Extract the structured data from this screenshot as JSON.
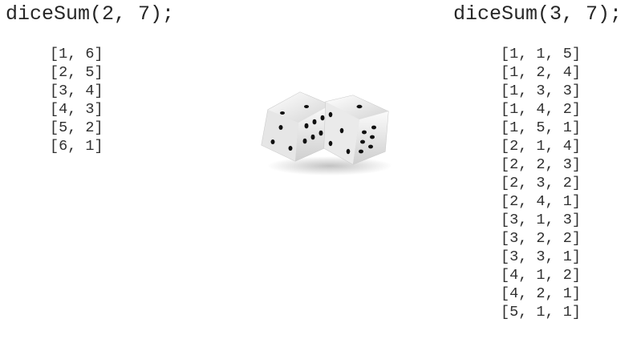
{
  "left": {
    "call": "diceSum(2, 7);",
    "results": [
      "[1, 6]",
      "[2, 5]",
      "[3, 4]",
      "[4, 3]",
      "[5, 2]",
      "[6, 1]"
    ]
  },
  "right": {
    "call": "diceSum(3, 7);",
    "results": [
      "[1, 1, 5]",
      "[1, 2, 4]",
      "[1, 3, 3]",
      "[1, 4, 2]",
      "[1, 5, 1]",
      "[2, 1, 4]",
      "[2, 2, 3]",
      "[2, 3, 2]",
      "[2, 4, 1]",
      "[3, 1, 3]",
      "[3, 2, 2]",
      "[3, 3, 1]",
      "[4, 1, 2]",
      "[4, 2, 1]",
      "[5, 1, 1]"
    ]
  },
  "image": {
    "icon": "dice-icon"
  }
}
